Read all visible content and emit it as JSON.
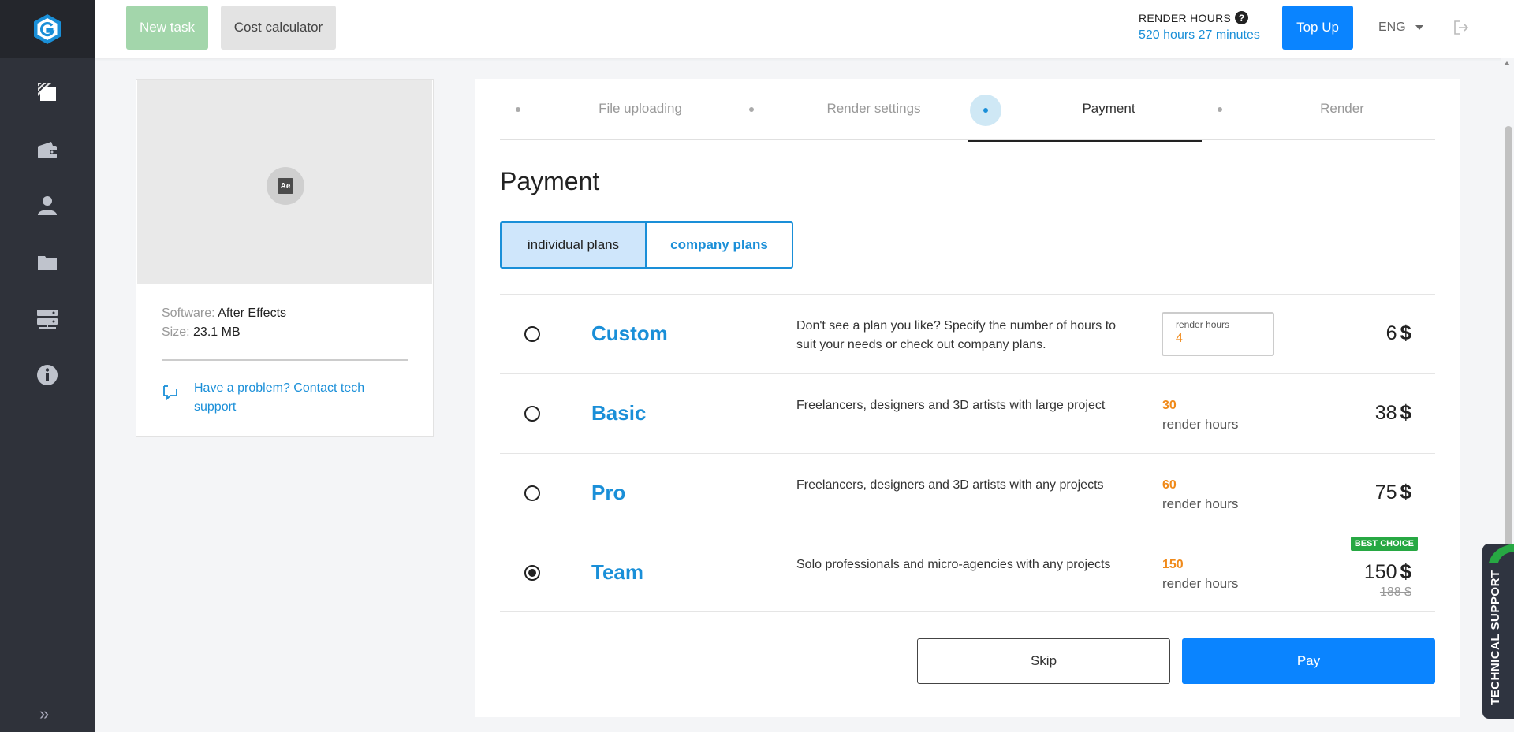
{
  "header": {
    "new_task": "New task",
    "cost_calculator": "Cost calculator",
    "render_hours_label": "RENDER HOURS",
    "render_hours_value": "520 hours 27 minutes",
    "top_up": "Top Up",
    "language": "ENG"
  },
  "file": {
    "software_label": "Software:",
    "software_value": "After Effects",
    "size_label": "Size:",
    "size_value": "23.1 MB",
    "app_badge": "Ae",
    "support_link": "Have a problem? Contact tech support"
  },
  "steps": [
    {
      "label": "File uploading"
    },
    {
      "label": "Render settings"
    },
    {
      "label": "Payment"
    },
    {
      "label": "Render"
    }
  ],
  "page_title": "Payment",
  "plan_tabs": {
    "individual": "individual plans",
    "company": "company plans"
  },
  "plans": [
    {
      "name": "Custom",
      "description": "Don't see a plan you like? Specify the number of hours to suit your needs or check out company plans.",
      "input_placeholder": "render hours",
      "input_value": "4",
      "price": "6",
      "currency": "$"
    },
    {
      "name": "Basic",
      "description": "Freelancers, designers and 3D artists with large project",
      "hours": "30",
      "hours_unit": "render hours",
      "price": "38",
      "currency": "$"
    },
    {
      "name": "Pro",
      "description": "Freelancers, designers and 3D artists with any projects",
      "hours": "60",
      "hours_unit": "render hours",
      "price": "75",
      "currency": "$"
    },
    {
      "name": "Team",
      "description": "Solo professionals and micro-agencies with any projects",
      "hours": "150",
      "hours_unit": "render hours",
      "price": "150",
      "currency": "$",
      "old_price": "188 $",
      "badge": "BEST CHOICE"
    }
  ],
  "actions": {
    "skip": "Skip",
    "pay": "Pay"
  },
  "tech_support": "TECHNICAL SUPPORT",
  "colors": {
    "accent": "#1a8fd8",
    "primary_button": "#0a84ff",
    "hours": "#f08a1a",
    "badge": "#27a843",
    "sidebar": "#2f323a"
  }
}
